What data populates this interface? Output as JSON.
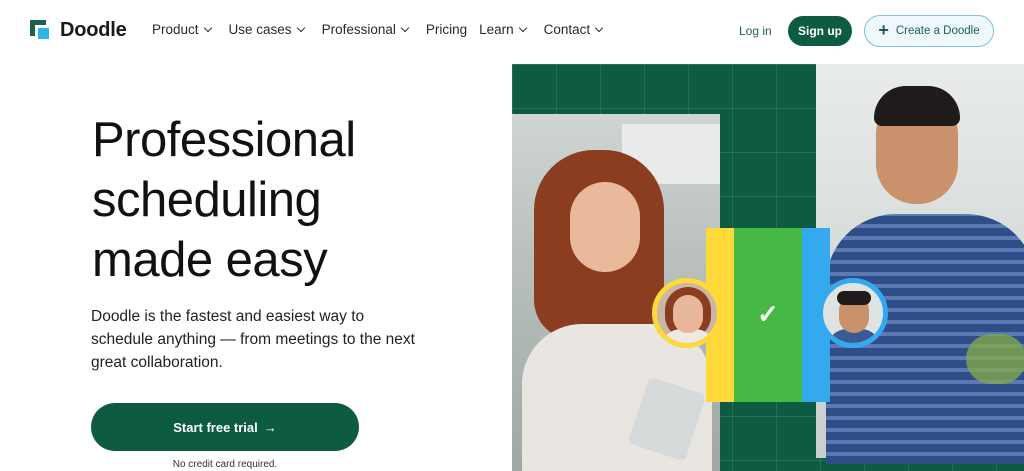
{
  "brand": {
    "name": "Doodle"
  },
  "nav": {
    "items": [
      {
        "label": "Product",
        "has_dropdown": true
      },
      {
        "label": "Use cases",
        "has_dropdown": true
      },
      {
        "label": "Professional",
        "has_dropdown": true
      },
      {
        "label": "Pricing",
        "has_dropdown": false
      },
      {
        "label": "Learn",
        "has_dropdown": true
      },
      {
        "label": "Contact",
        "has_dropdown": true
      }
    ],
    "login_label": "Log in",
    "signup_label": "Sign up",
    "create_label": "Create a Doodle"
  },
  "hero": {
    "headline_lines": [
      "Professional",
      "scheduling",
      "made easy"
    ],
    "description_lines": [
      "Doodle is the fastest and easiest way to",
      "schedule anything — from meetings to the next",
      "great collaboration."
    ],
    "cta_label": "Start free trial",
    "cta_arrow": "→",
    "note": "No credit card required."
  },
  "colors": {
    "brand_green": "#0e5b44",
    "accent_blue": "#33a9ef",
    "accent_yellow": "#ffd83a",
    "accent_green": "#46b844"
  },
  "icons": {
    "logo": "doodle-logo-icon",
    "chevron": "chevron-down-icon",
    "plus": "plus-icon",
    "arrow": "arrow-right-icon",
    "check": "check-icon"
  }
}
